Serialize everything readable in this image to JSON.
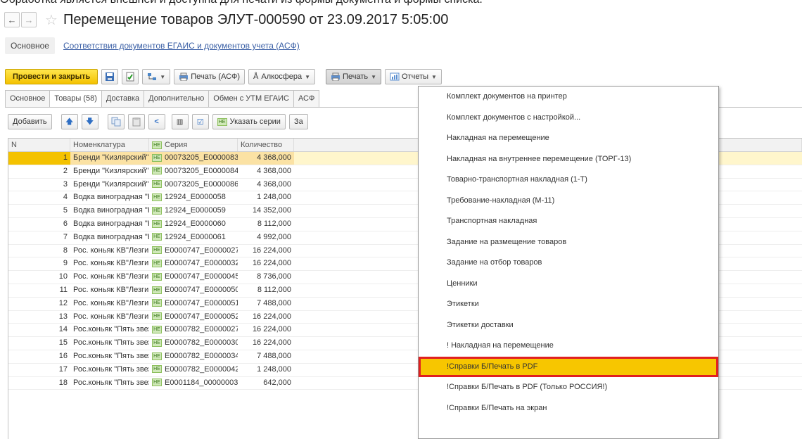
{
  "caption_top": "Обработка является внешней и доступна для печати из формы документа и формы списка.",
  "window": {
    "back_icon": "arrow-left-icon",
    "forward_icon": "arrow-right-icon",
    "favorite_icon": "star-icon",
    "title": "Перемещение товаров ЭЛУТ-000590 от 23.09.2017 5:05:00"
  },
  "sections": {
    "main": "Основное",
    "link": "Соответствия документов ЕГАИС и документов учета (АСФ)"
  },
  "toolbar": {
    "post_close": "Провести и закрыть",
    "print_asf": "Печать (АСФ)",
    "alcosfera": "Алкосфера",
    "print": "Печать",
    "reports": "Отчеты"
  },
  "tabs": [
    "Основное",
    "Товары (58)",
    "Доставка",
    "Дополнительно",
    "Обмен с УТМ ЕГАИС",
    "АСФ"
  ],
  "table_toolbar": {
    "add": "Добавить",
    "specify_series": "Указать серии",
    "cut_label": "За"
  },
  "table": {
    "headers": {
      "n": "N",
      "nom": "Номенклатура",
      "series": "Серия",
      "qty": "Количество"
    },
    "series_badge": "НЕ",
    "rows": [
      {
        "n": "1",
        "nom": "Бренди \"Кизлярский\" Ма...",
        "series": "00073205_E0000083",
        "qty": "4 368,000"
      },
      {
        "n": "2",
        "nom": "Бренди \"Кизлярский\" Ма...",
        "series": "00073205_E0000084",
        "qty": "4 368,000"
      },
      {
        "n": "3",
        "nom": "Бренди \"Кизлярский\" Ма...",
        "series": "00073205_E0000086",
        "qty": "4 368,000"
      },
      {
        "n": "4",
        "nom": "Водка виноградная \"Киз...",
        "series": "12924_E0000058",
        "qty": "1 248,000"
      },
      {
        "n": "5",
        "nom": "Водка виноградная \"Киз...",
        "series": "12924_E0000059",
        "qty": "14 352,000"
      },
      {
        "n": "6",
        "nom": "Водка виноградная \"Киз...",
        "series": "12924_E0000060",
        "qty": "8 112,000"
      },
      {
        "n": "7",
        "nom": "Водка виноградная \"Киз...",
        "series": "12924_E0000061",
        "qty": "4 992,000"
      },
      {
        "n": "8",
        "nom": "Рос. коньяк КВ\"Лезгинк...",
        "series": "E0000747_E0000027",
        "qty": "16 224,000"
      },
      {
        "n": "9",
        "nom": "Рос. коньяк КВ\"Лезгинк...",
        "series": "E0000747_E0000032",
        "qty": "16 224,000"
      },
      {
        "n": "10",
        "nom": "Рос. коньяк КВ\"Лезгинк...",
        "series": "E0000747_E0000045",
        "qty": "8 736,000"
      },
      {
        "n": "11",
        "nom": "Рос. коньяк КВ\"Лезгинк...",
        "series": "E0000747_E0000050",
        "qty": "8 112,000"
      },
      {
        "n": "12",
        "nom": "Рос. коньяк КВ\"Лезгинк...",
        "series": "E0000747_E0000051",
        "qty": "7 488,000"
      },
      {
        "n": "13",
        "nom": "Рос. коньяк КВ\"Лезгинк...",
        "series": "E0000747_E0000052",
        "qty": "16 224,000"
      },
      {
        "n": "14",
        "nom": "Рос.коньяк \"Пять звездо...",
        "series": "E0000782_E0000027",
        "qty": "16 224,000"
      },
      {
        "n": "15",
        "nom": "Рос.коньяк \"Пять звездо...",
        "series": "E0000782_E0000030",
        "qty": "16 224,000"
      },
      {
        "n": "16",
        "nom": "Рос.коньяк \"Пять звездо...",
        "series": "E0000782_E0000034",
        "qty": "7 488,000"
      },
      {
        "n": "17",
        "nom": "Рос.коньяк \"Пять звездо...",
        "series": "E0000782_E0000042",
        "qty": "1 248,000"
      },
      {
        "n": "18",
        "nom": "Рос.коньяк \"Пять звездо...",
        "series": "E0001184_00000003",
        "qty": "642,000"
      }
    ]
  },
  "print_menu": {
    "items": [
      "Комплект документов на принтер",
      "Комплект документов с настройкой...",
      "Накладная на перемещение",
      "Накладная на внутреннее перемещение (ТОРГ-13)",
      "Товарно-транспортная накладная (1-Т)",
      "Требование-накладная (М-11)",
      "Транспортная накладная",
      "Задание на размещение товаров",
      "Задание на отбор товаров",
      "Ценники",
      "Этикетки",
      "Этикетки доставки",
      "! Накладная на перемещение",
      "!Справки Б/Печать в PDF",
      "!Справки Б/Печать в PDF (Только РОССИЯ!)",
      "!Справки Б/Печать на экран"
    ],
    "highlighted_index": 13
  },
  "colors": {
    "primary_button": "#f4c200",
    "selected_row": "#fbe2a4",
    "highlight_frame": "#e02020",
    "link": "#3a5fa5"
  }
}
